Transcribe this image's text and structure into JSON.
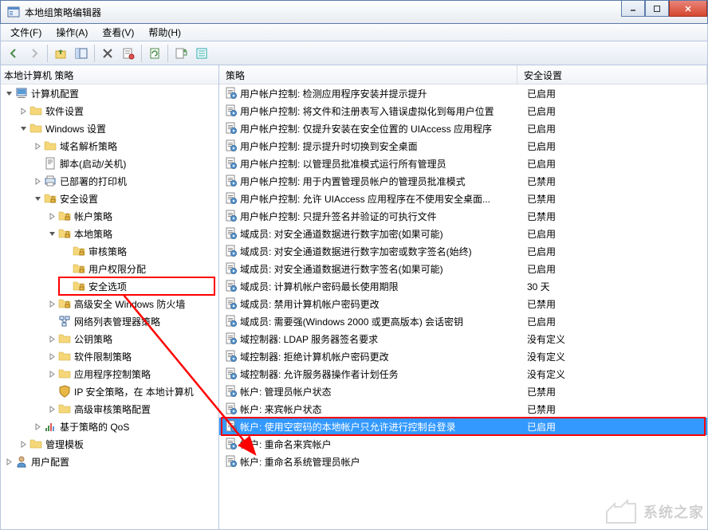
{
  "window": {
    "title": "本地组策略编辑器"
  },
  "menu": {
    "file": "文件(F)",
    "action": "操作(A)",
    "view": "查看(V)",
    "help": "帮助(H)"
  },
  "tree": {
    "root": "本地计算机 策略",
    "computer_config": "计算机配置",
    "software_settings": "软件设置",
    "windows_settings": "Windows 设置",
    "name_resolution": "域名解析策略",
    "scripts": "脚本(启动/关机)",
    "deployed_printers": "已部署的打印机",
    "security_settings": "安全设置",
    "account_policies": "帐户策略",
    "local_policies": "本地策略",
    "audit_policy": "审核策略",
    "user_rights": "用户权限分配",
    "security_options": "安全选项",
    "firewall": "高级安全 Windows 防火墙",
    "network_list": "网络列表管理器策略",
    "public_key": "公钥策略",
    "software_restriction": "软件限制策略",
    "app_control": "应用程序控制策略",
    "ip_security": "IP 安全策略，在 本地计算机",
    "advanced_audit": "高级审核策略配置",
    "policy_qos": "基于策略的 QoS",
    "admin_templates": "管理模板",
    "user_config": "用户配置"
  },
  "list": {
    "header_policy": "策略",
    "header_setting": "安全设置",
    "rows": [
      {
        "policy": "用户帐户控制: 检测应用程序安装并提示提升",
        "setting": "已启用"
      },
      {
        "policy": "用户帐户控制: 将文件和注册表写入错误虚拟化到每用户位置",
        "setting": "已启用"
      },
      {
        "policy": "用户帐户控制: 仅提升安装在安全位置的 UIAccess 应用程序",
        "setting": "已启用"
      },
      {
        "policy": "用户帐户控制: 提示提升时切换到安全桌面",
        "setting": "已启用"
      },
      {
        "policy": "用户帐户控制: 以管理员批准模式运行所有管理员",
        "setting": "已启用"
      },
      {
        "policy": "用户帐户控制: 用于内置管理员帐户的管理员批准模式",
        "setting": "已禁用"
      },
      {
        "policy": "用户帐户控制: 允许 UIAccess 应用程序在不使用安全桌面...",
        "setting": "已禁用"
      },
      {
        "policy": "用户帐户控制: 只提升签名并验证的可执行文件",
        "setting": "已禁用"
      },
      {
        "policy": "域成员: 对安全通道数据进行数字加密(如果可能)",
        "setting": "已启用"
      },
      {
        "policy": "域成员: 对安全通道数据进行数字加密或数字签名(始终)",
        "setting": "已启用"
      },
      {
        "policy": "域成员: 对安全通道数据进行数字签名(如果可能)",
        "setting": "已启用"
      },
      {
        "policy": "域成员: 计算机帐户密码最长使用期限",
        "setting": "30 天"
      },
      {
        "policy": "域成员: 禁用计算机帐户密码更改",
        "setting": "已禁用"
      },
      {
        "policy": "域成员: 需要强(Windows 2000 或更高版本) 会话密钥",
        "setting": "已启用"
      },
      {
        "policy": "域控制器: LDAP 服务器签名要求",
        "setting": "没有定义"
      },
      {
        "policy": "域控制器: 拒绝计算机帐户密码更改",
        "setting": "没有定义"
      },
      {
        "policy": "域控制器: 允许服务器操作者计划任务",
        "setting": "没有定义"
      },
      {
        "policy": "帐户: 管理员帐户状态",
        "setting": "已禁用"
      },
      {
        "policy": "帐户: 来宾帐户状态",
        "setting": "已禁用"
      },
      {
        "policy": "帐户: 使用空密码的本地帐户只允许进行控制台登录",
        "setting": "已启用"
      },
      {
        "policy": "帐户: 重命名来宾帐户",
        "setting": ""
      },
      {
        "policy": "帐户: 重命名系统管理员帐户",
        "setting": ""
      }
    ]
  },
  "watermark": {
    "text": "系统之家"
  }
}
